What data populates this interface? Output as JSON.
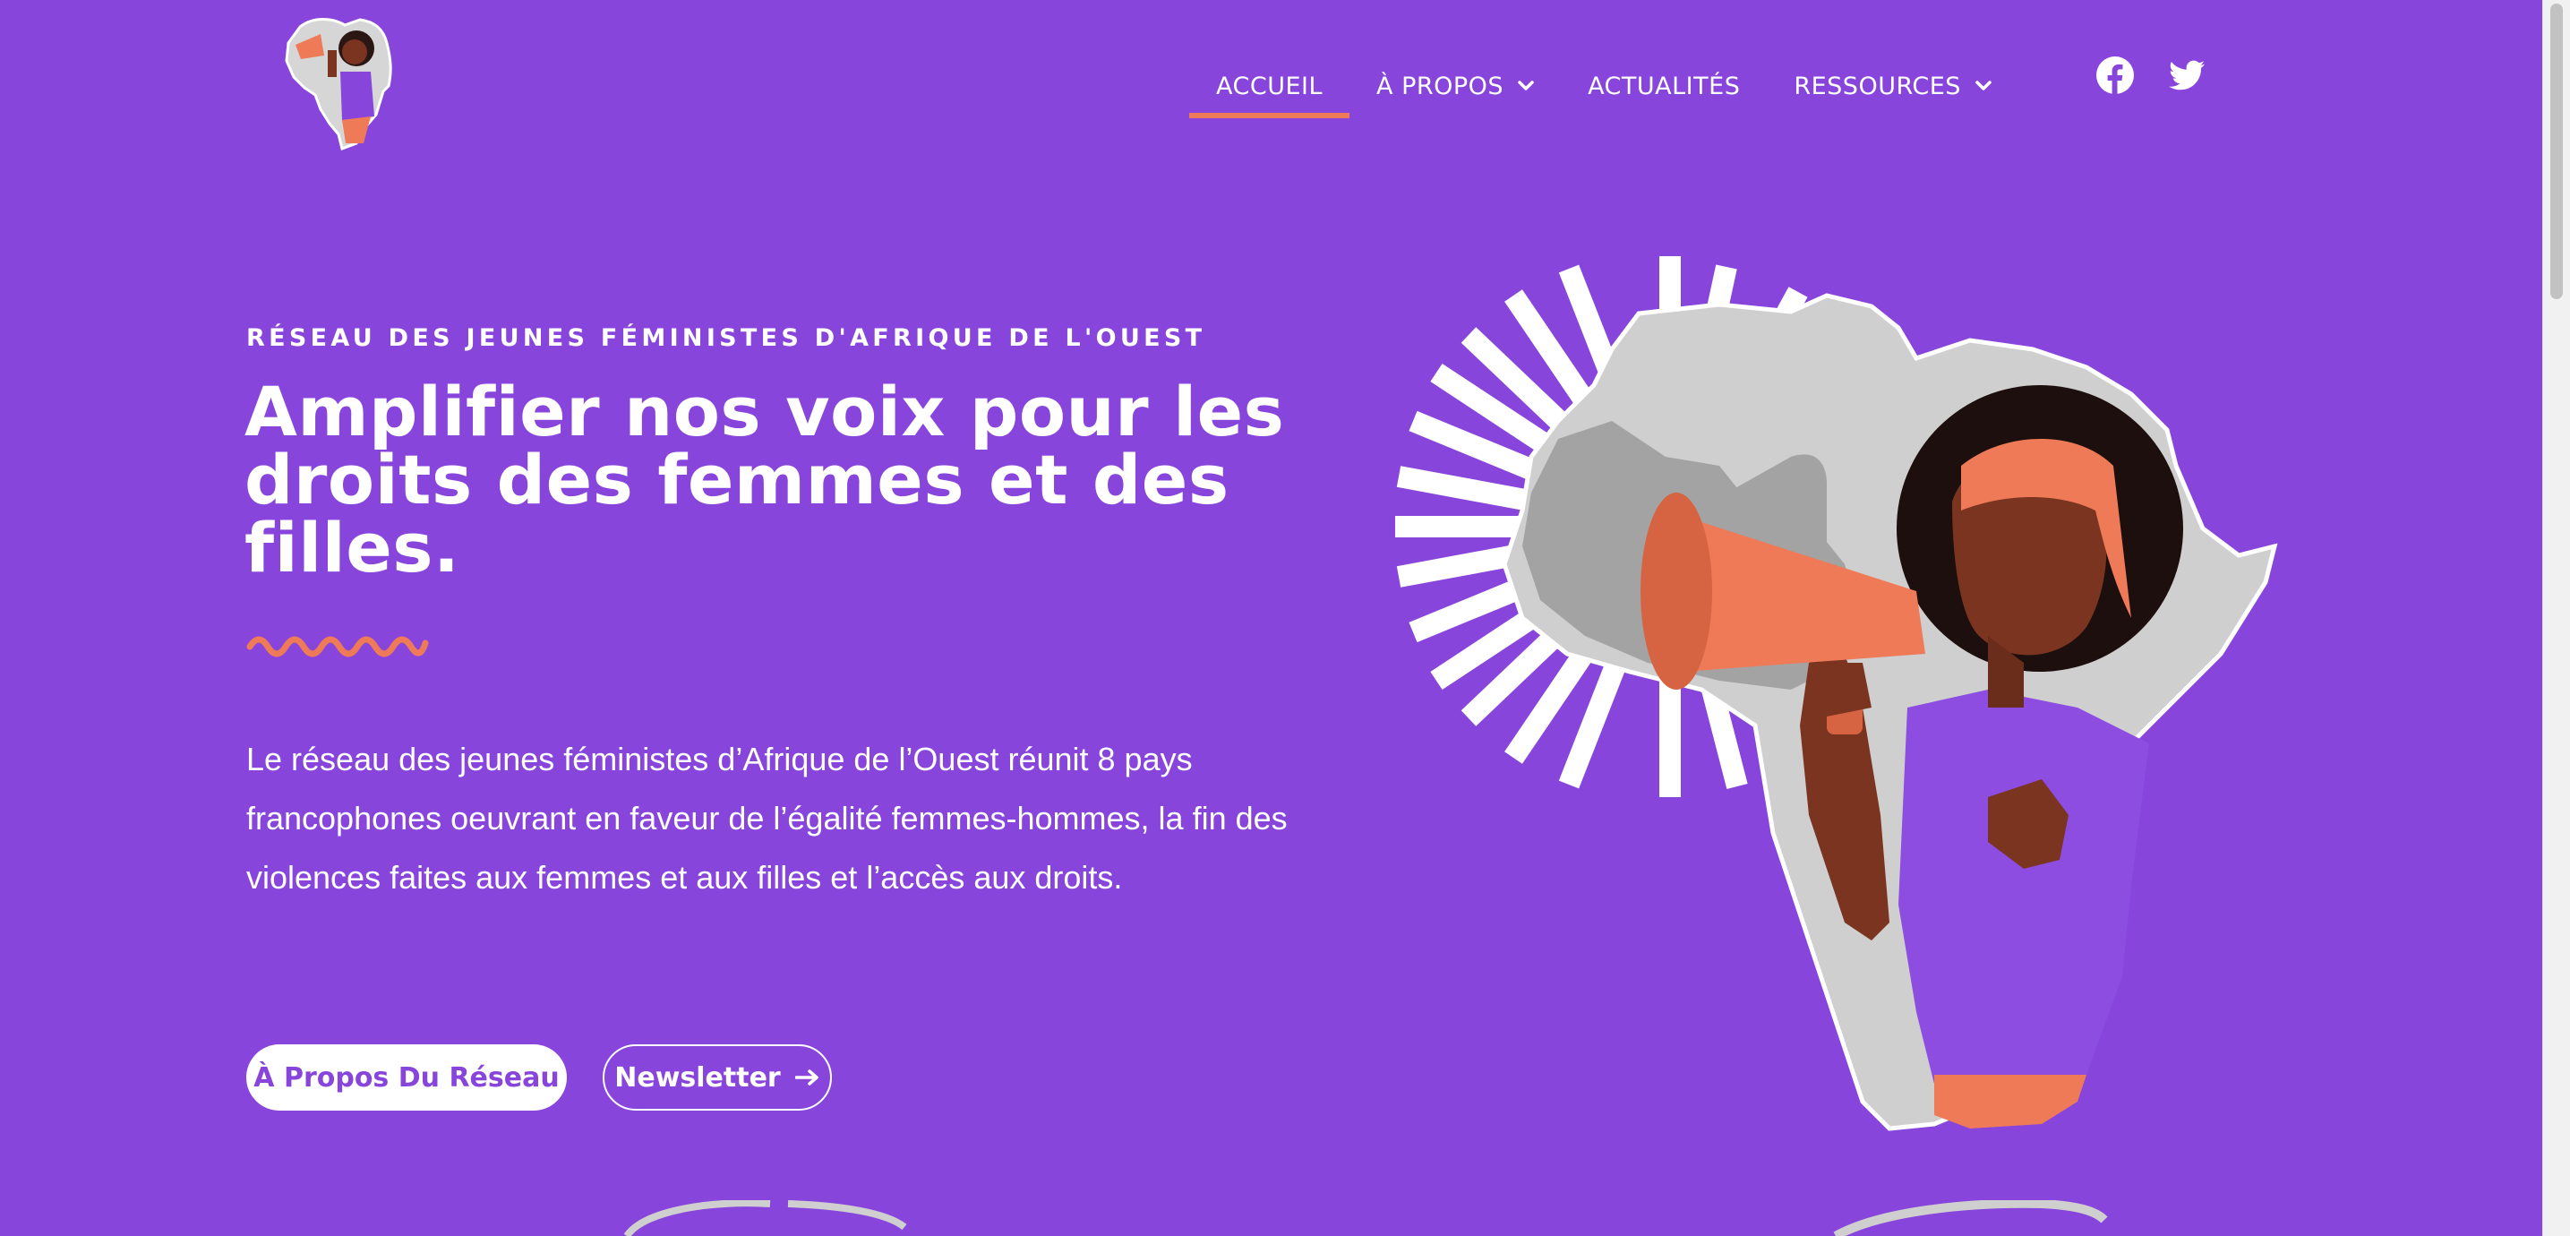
{
  "header": {
    "logo_icon": "megaphone-woman-africa-logo",
    "nav": [
      {
        "label": "ACCUEIL",
        "active": true,
        "dropdown": false
      },
      {
        "label": "À PROPOS",
        "active": false,
        "dropdown": true
      },
      {
        "label": "ACTUALITÉS",
        "active": false,
        "dropdown": false
      },
      {
        "label": "RESSOURCES",
        "active": false,
        "dropdown": true
      }
    ],
    "social": [
      {
        "icon": "facebook-icon"
      },
      {
        "icon": "twitter-icon"
      }
    ]
  },
  "hero": {
    "eyebrow": "RÉSEAU DES JEUNES FÉMINISTES D'AFRIQUE DE L'OUEST",
    "headline": "Amplifier nos voix pour les droits des femmes et des filles.",
    "description": "Le réseau des jeunes féministes d’Afrique de l’Ouest réunit 8 pays francophones oeuvrant en faveur de l’égalité femmes-hommes, la fin des violences faites aux femmes et aux filles et l’accès aux droits.",
    "primary_button": "À Propos Du Réseau",
    "secondary_button": "Newsletter",
    "illustration_icon": "woman-megaphone-africa-illustration"
  },
  "colors": {
    "background": "#8845dc",
    "accent": "#ee7a58",
    "text": "#ffffff",
    "africa_map": "#cfcfcf",
    "skin": "#7a3420"
  }
}
